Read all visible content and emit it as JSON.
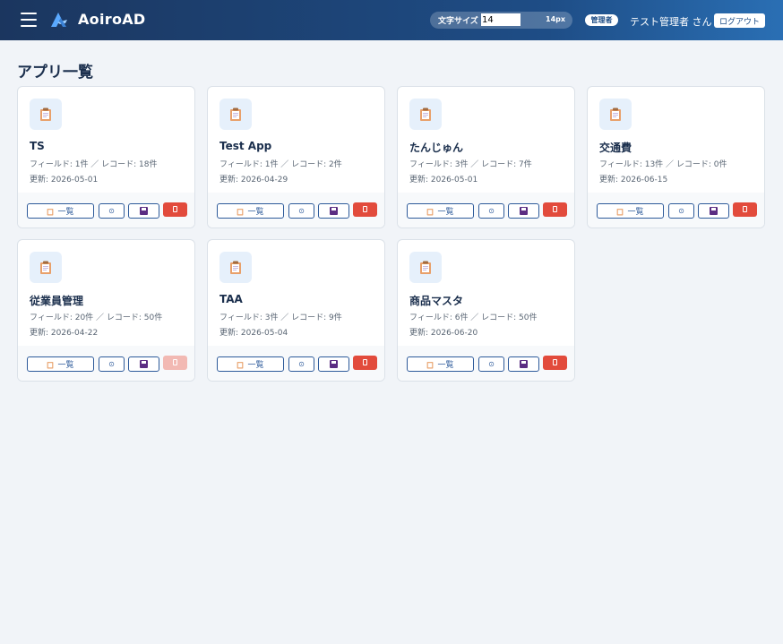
{
  "header": {
    "brand": "AoiroAD",
    "font_size_label": "文字サイズ",
    "font_size_input": "14",
    "font_size_value": "14px",
    "role_badge": "管理者",
    "user_name": "テスト管理者 さん",
    "logout_label": "ログアウト",
    "colors": {
      "bar_start": "#1b365f",
      "bar_end": "#2a6fb4"
    }
  },
  "page_title": "アプリ一覧",
  "buttons": {
    "list_label": "一覧",
    "settings_glyph": "⊙"
  },
  "apps": [
    {
      "name": "TS",
      "meta": "フィールド: 1件 ／ レコード: 18件",
      "updated": "更新: 2026-05-01",
      "delete_enabled": true
    },
    {
      "name": "Test App",
      "meta": "フィールド: 1件 ／ レコード: 2件",
      "updated": "更新: 2026-04-29",
      "delete_enabled": true
    },
    {
      "name": "たんじゅん",
      "meta": "フィールド: 3件 ／ レコード: 7件",
      "updated": "更新: 2026-05-01",
      "delete_enabled": true
    },
    {
      "name": "交通費",
      "meta": "フィールド: 13件 ／ レコード: 0件",
      "updated": "更新: 2026-06-15",
      "delete_enabled": true
    },
    {
      "name": "従業員管理",
      "meta": "フィールド: 20件 ／ レコード: 50件",
      "updated": "更新: 2026-04-22",
      "delete_enabled": false
    },
    {
      "name": "TAA",
      "meta": "フィールド: 3件 ／ レコード: 9件",
      "updated": "更新: 2026-05-04",
      "delete_enabled": true
    },
    {
      "name": "商品マスタ",
      "meta": "フィールド: 6件 ／ レコード: 50件",
      "updated": "更新: 2026-06-20",
      "delete_enabled": true
    }
  ],
  "icons": {
    "menu": "hamburger-icon",
    "logo": "aoiro-logo-icon",
    "app": "clipboard-icon",
    "settings": "gear-icon",
    "save": "floppy-disk-icon",
    "delete": "trash-icon"
  },
  "colors": {
    "accent": "#2d5a9a",
    "danger": "#e24b3c",
    "danger_disabled": "#f2b9b3",
    "page_bg": "#f1f4f8",
    "icon_bg": "#e6f0fb"
  }
}
